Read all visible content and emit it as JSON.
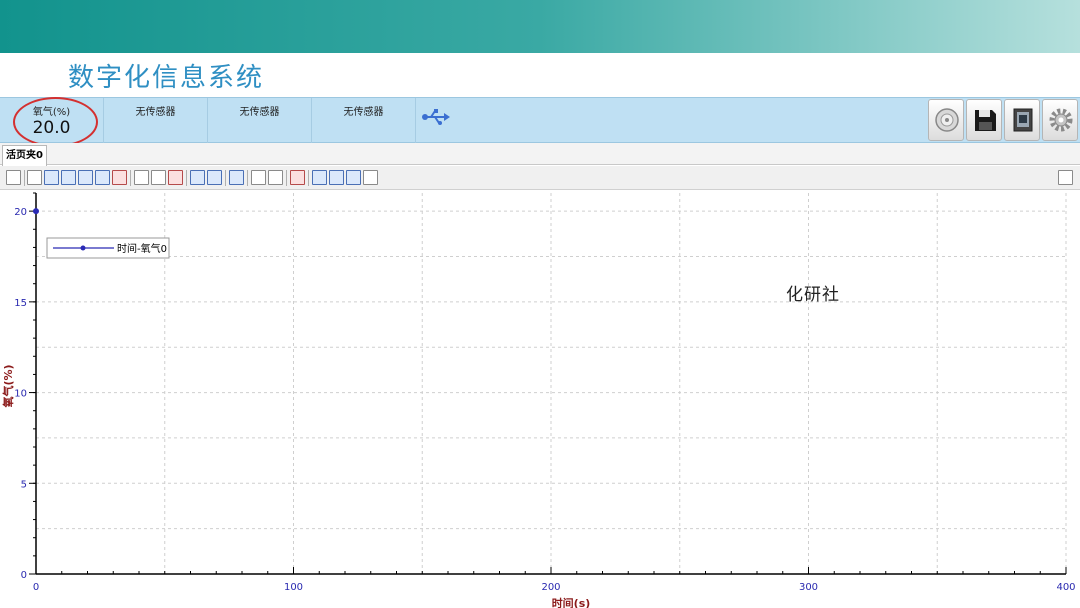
{
  "app": {
    "title": "数字化信息系统"
  },
  "sensors": [
    {
      "label": "氧气(%)",
      "value": "20.0"
    },
    {
      "label": "无传感器",
      "value": ""
    },
    {
      "label": "无传感器",
      "value": ""
    },
    {
      "label": "无传感器",
      "value": ""
    }
  ],
  "icons": {
    "usb": "usb-icon",
    "toolbar_buttons": [
      "disc-icon",
      "save-icon",
      "book-icon",
      "gear-icon"
    ]
  },
  "tabs": [
    {
      "label": "活页夹0",
      "active": true
    }
  ],
  "watermark": "化研社",
  "colors": {
    "axis_tick_text": "#2a2ab0",
    "axis_label_text": "#8b1a1a",
    "series_line": "#2b2bb5",
    "highlight": "#d43030"
  },
  "chart_data": {
    "type": "line",
    "xlabel": "时间(s)",
    "ylabel": "氧气(%)",
    "xlim": [
      0,
      400
    ],
    "ylim": [
      0,
      21
    ],
    "xticks": [
      0,
      100,
      200,
      300,
      400
    ],
    "yticks": [
      0,
      5,
      10,
      15,
      20
    ],
    "grid": true,
    "legend_placement": "top-left",
    "series": [
      {
        "name": "时间-氧气0",
        "x": [
          0
        ],
        "y": [
          20.0
        ]
      }
    ]
  }
}
